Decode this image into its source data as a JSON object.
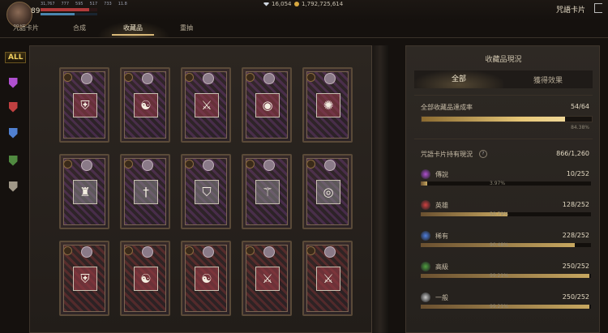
{
  "player": {
    "level": "89",
    "stats": [
      "31,767",
      "777",
      "595",
      "517",
      "733",
      "11.8"
    ]
  },
  "currency": {
    "gems": "16,054",
    "gold": "1,792,725,614"
  },
  "window_title": "咒語卡片",
  "tabs": [
    {
      "label": "咒語卡片"
    },
    {
      "label": "合成"
    },
    {
      "label": "收藏品"
    },
    {
      "label": "重抽"
    }
  ],
  "left_nav": {
    "all_label": "ALL",
    "icons": [
      "legendary-filter-icon",
      "heroic-filter-icon",
      "rare-filter-icon",
      "advanced-filter-icon",
      "common-filter-icon"
    ]
  },
  "cards": [
    {
      "emblem": "shield",
      "tint": "purple"
    },
    {
      "emblem": "swirl",
      "tint": "purple"
    },
    {
      "emblem": "crossed-swords",
      "tint": "purple"
    },
    {
      "emblem": "eye",
      "tint": "purple"
    },
    {
      "emblem": "dragon",
      "tint": "purple"
    },
    {
      "emblem": "armor",
      "tint": "purple"
    },
    {
      "emblem": "sword",
      "tint": "purple"
    },
    {
      "emblem": "shield-sword",
      "tint": "purple"
    },
    {
      "emblem": "blade",
      "tint": "purple"
    },
    {
      "emblem": "orb",
      "tint": "purple"
    },
    {
      "emblem": "shield",
      "tint": "red"
    },
    {
      "emblem": "swirl",
      "tint": "red"
    },
    {
      "emblem": "swirl",
      "tint": "red"
    },
    {
      "emblem": "crossed-swords",
      "tint": "red"
    },
    {
      "emblem": "crossed-swords",
      "tint": "red"
    }
  ],
  "collection": {
    "title": "收藏品現況",
    "tabs": [
      "全部",
      "獲得效果"
    ],
    "overall": {
      "label": "全部收藏品達成率",
      "value": "54/64",
      "percent": "84.38%",
      "fraction": 0.8438
    },
    "spell": {
      "label": "咒語卡片持有現況",
      "value": "866/1,260"
    },
    "grades": [
      {
        "name": "傳說",
        "value": "10/252",
        "percent": "3.97%",
        "fraction": 0.0397,
        "color": "#b050d0"
      },
      {
        "name": "英雄",
        "value": "128/252",
        "percent": "50.79%",
        "fraction": 0.5079,
        "color": "#d04040"
      },
      {
        "name": "稀有",
        "value": "228/252",
        "percent": "90.48%",
        "fraction": 0.9048,
        "color": "#5080e0"
      },
      {
        "name": "高級",
        "value": "250/252",
        "percent": "99.21%",
        "fraction": 0.9921,
        "color": "#50a040"
      },
      {
        "name": "一般",
        "value": "250/252",
        "percent": "99.21%",
        "fraction": 0.9921,
        "color": "#c8c8c8"
      }
    ]
  }
}
